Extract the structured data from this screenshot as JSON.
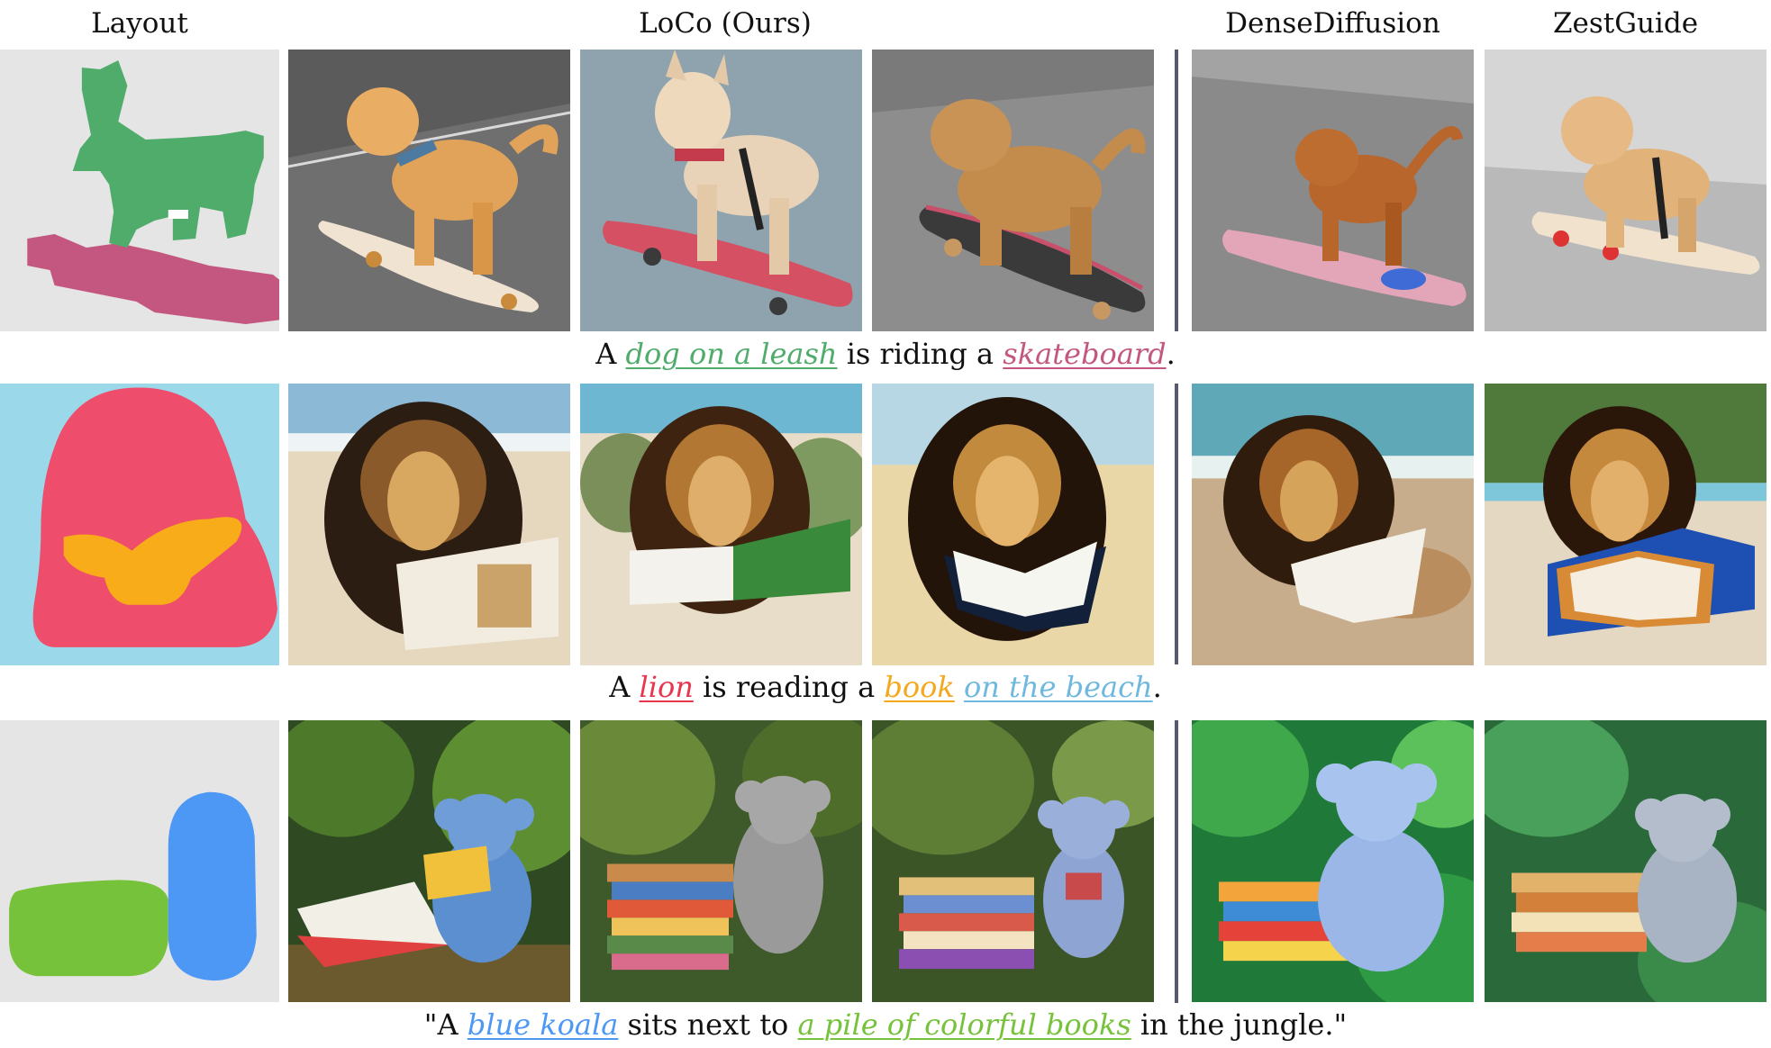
{
  "headers": {
    "layout": "Layout",
    "ours": "LoCo (Ours)",
    "dense": "DenseDiffusion",
    "zest": "ZestGuide"
  },
  "colors": {
    "dog": "#4fac6b",
    "skateboard": "#c4577f",
    "lion": "#e8364e",
    "book": "#f4a81d",
    "beach": "#6fb8e0",
    "koala": "#4d97f5",
    "books": "#76c23a"
  },
  "rows": [
    {
      "subject": "dog-skateboard",
      "caption": {
        "p1": "A ",
        "phrase1": "dog on a leash",
        "p2": " is riding a ",
        "phrase2": "skateboard",
        "p3": "."
      }
    },
    {
      "subject": "lion-book",
      "caption": {
        "p1": "A ",
        "phrase1": "lion",
        "p2": " is reading a ",
        "phrase2": "book",
        "p3": " ",
        "phrase3": "on the beach",
        "p4": "."
      }
    },
    {
      "subject": "koala-books",
      "caption": {
        "p1": "\"A ",
        "phrase1": "blue koala",
        "p2": " sits next to ",
        "phrase2": "a pile of colorful books",
        "p3": " in the jungle.\""
      }
    }
  ]
}
